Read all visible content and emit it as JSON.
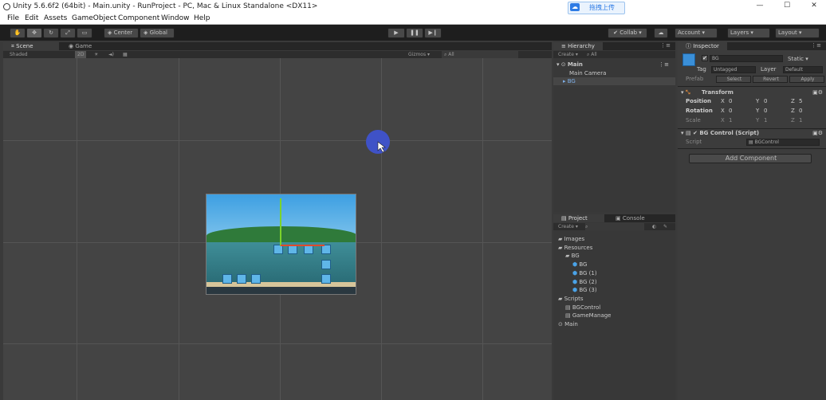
{
  "window": {
    "title": "Unity 5.6.6f2 (64bit) - Main.unity - RunProject - PC, Mac & Linux Standalone <DX11>",
    "upload_label": "拖拽上传",
    "controls": [
      "—",
      "☐",
      "✕"
    ]
  },
  "menu": [
    "File",
    "Edit",
    "Assets",
    "GameObject",
    "Component",
    "Window",
    "Help"
  ],
  "toolbar": {
    "pivot": "Center",
    "space": "Global",
    "collab": "Collab ▾",
    "account": "Account",
    "layers": "Layers",
    "layout": "Layout"
  },
  "scene_panel": {
    "tabs": [
      "Scene",
      "Game"
    ],
    "shading": "Shaded",
    "mode_2d": "2D",
    "gizmos": "Gizmos",
    "search": "All"
  },
  "hierarchy": {
    "tab": "Hierarchy",
    "create": "Create ▾",
    "search": "All",
    "scene": "Main",
    "items": [
      "Main Camera",
      "BG"
    ]
  },
  "project": {
    "tabs": [
      "Project",
      "Console"
    ],
    "create": "Create ▾",
    "items": [
      {
        "label": "Images",
        "type": "folder",
        "indent": 0
      },
      {
        "label": "Resources",
        "type": "folder",
        "indent": 0
      },
      {
        "label": "BG",
        "type": "folder",
        "indent": 1
      },
      {
        "label": "BG",
        "type": "prefab",
        "indent": 2
      },
      {
        "label": "BG (1)",
        "type": "prefab",
        "indent": 2
      },
      {
        "label": "BG (2)",
        "type": "prefab",
        "indent": 2
      },
      {
        "label": "BG (3)",
        "type": "prefab",
        "indent": 2
      },
      {
        "label": "Scripts",
        "type": "folder",
        "indent": 0
      },
      {
        "label": "BGControl",
        "type": "script",
        "indent": 1
      },
      {
        "label": "GameManage",
        "type": "script",
        "indent": 1
      },
      {
        "label": "Main",
        "type": "scene",
        "indent": 0
      }
    ]
  },
  "inspector": {
    "tab": "Inspector",
    "object_name": "BG",
    "static_label": "Static ▾",
    "tag_label": "Tag",
    "tag_value": "Untagged",
    "layer_label": "Layer",
    "layer_value": "Default",
    "prefab_label": "Prefab",
    "prefab_buttons": [
      "Select",
      "Revert",
      "Apply"
    ],
    "transform": {
      "title": "Transform",
      "rows": [
        {
          "label": "Position",
          "x": "0",
          "y": "0",
          "z": "5"
        },
        {
          "label": "Rotation",
          "x": "0",
          "y": "0",
          "z": "0"
        },
        {
          "label": "Scale",
          "x": "1",
          "y": "1",
          "z": "1"
        }
      ]
    },
    "component": {
      "title": "BG Control (Script)",
      "script_label": "Script",
      "script_value": "BGControl"
    },
    "add_component": "Add Component"
  }
}
